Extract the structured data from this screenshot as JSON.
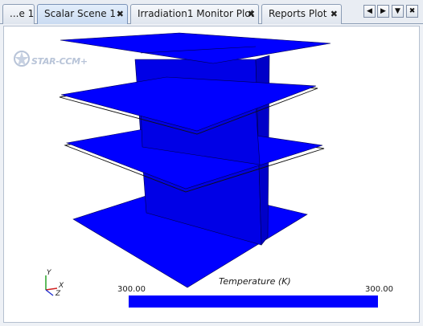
{
  "tabs": [
    {
      "label": "...e 1",
      "closable": false,
      "active": false
    },
    {
      "label": "Scalar Scene 1",
      "closable": true,
      "active": true
    },
    {
      "label": "Irradiation1 Monitor Plot",
      "closable": true,
      "active": false
    },
    {
      "label": "Reports Plot",
      "closable": true,
      "active": false
    }
  ],
  "tab_close_glyph": "✖",
  "nav": {
    "left_glyph": "◀",
    "right_glyph": "▶",
    "menu_glyph": "▼",
    "close_glyph": "✖"
  },
  "scene": {
    "watermark": "STAR-CCM+",
    "geometry_color": "#0000ff",
    "legend": {
      "title": "Temperature (K)",
      "min_label": "300.00",
      "max_label": "300.00",
      "bar_color": "#0000ff"
    },
    "axes": {
      "y": "Y",
      "x": "X",
      "z": "Z"
    }
  },
  "icons": [
    "star-ccm-logo-icon",
    "axis-triad-icon",
    "scroll-left-icon",
    "scroll-right-icon",
    "tab-list-icon",
    "close-icon"
  ]
}
